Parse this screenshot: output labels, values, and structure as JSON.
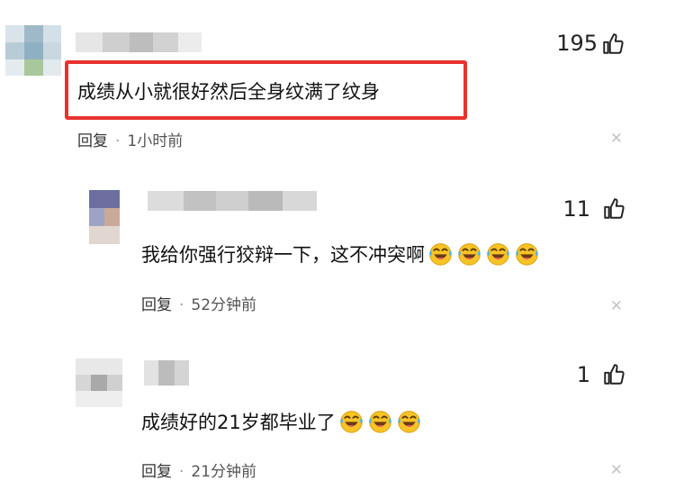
{
  "comments": [
    {
      "likes": "195",
      "text": "成绩从小就很好然后全身纹满了纹身",
      "reply_label": "回复",
      "separator": "·",
      "time": "1小时前",
      "close_icon": "close-icon",
      "highlighted": true,
      "highlight_color": "#e8322f"
    },
    {
      "likes": "11",
      "text": "我给你强行狡辩一下，这不冲突啊",
      "emoji": "laughing-crying-emoji",
      "emoji_count": 4,
      "reply_label": "回复",
      "separator": "·",
      "time": "52分钟前",
      "close_icon": "close-icon"
    },
    {
      "likes": "1",
      "text": "成绩好的21岁都毕业了",
      "emoji": "laughing-crying-emoji",
      "emoji_count": 3,
      "reply_label": "回复",
      "separator": "·",
      "time": "21分钟前",
      "close_icon": "close-icon"
    }
  ]
}
